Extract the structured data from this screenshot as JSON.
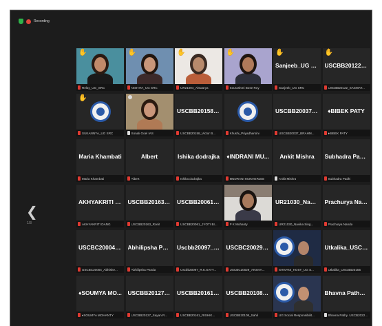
{
  "recording_label": "Recording",
  "page_indicator": "1/3",
  "tiles": [
    {
      "display": "",
      "label": "Relay_UG_SRC",
      "video": true,
      "mic_muted": true,
      "hand": true,
      "bg": "#4a8f9e",
      "skin": "#c08a6a",
      "shirt": "#1a1a1a",
      "hair": "#2a1a12"
    },
    {
      "display": "",
      "label": "NISHITA_UG SRC",
      "video": true,
      "mic_muted": true,
      "hand": true,
      "bg": "#6f8fb0",
      "skin": "#c9977a",
      "shirt": "#3c2a2a",
      "hair": "#22160f"
    },
    {
      "display": "",
      "label": "UR21004_Aiswarya",
      "video": true,
      "mic_muted": true,
      "hand": true,
      "bg": "#ece8e4",
      "skin": "#b88a6c",
      "shirt": "#ba5e3a",
      "hair": "#3a2a22"
    },
    {
      "display": "",
      "label": "Sourashmi Bose Roy",
      "video": true,
      "mic_muted": true,
      "hand": true,
      "bg": "#a9a4ce",
      "skin": "#b07a5a",
      "shirt": "#2d2f3a",
      "hair": "#1f1510"
    },
    {
      "display": "Sanjeeb_UG SRC",
      "label": "Sanjeeb_UG SRC",
      "video": false,
      "mic_muted": true,
      "hand": true
    },
    {
      "display": "USCBB20122_S...",
      "label": "USCBB20122_SASWAT...",
      "video": false,
      "mic_muted": true,
      "hand": true
    },
    {
      "display": "",
      "label": "SUKANNYA_UG SRC",
      "video": false,
      "mic_muted": true,
      "hand": true,
      "logo": true
    },
    {
      "display": "",
      "label": "Sonali Goel IAS",
      "video": true,
      "mic_muted": false,
      "spotlight": true,
      "bg": "#a38f6f",
      "skin": "#c9967a",
      "shirt": "#b07a55",
      "hair": "#2a1a10"
    },
    {
      "display": "USCBB20158_Vi...",
      "label": "USCBB20158_Victor B...",
      "video": false,
      "mic_muted": true
    },
    {
      "display": "",
      "label": "Khushi_Priyadharsini",
      "video": false,
      "mic_muted": true,
      "logo": true
    },
    {
      "display": "USCBB20037_B...",
      "label": "USCBB20037_BRAHM...",
      "video": false,
      "mic_muted": true
    },
    {
      "display": "♦BIBEK PATY",
      "label": "♦BIBEK PATY",
      "video": false,
      "mic_muted": true
    },
    {
      "display": "Maria Khambati",
      "label": "Maria Khambati",
      "video": false,
      "mic_muted": true
    },
    {
      "display": "Albert",
      "label": "Albert",
      "video": false,
      "mic_muted": true
    },
    {
      "display": "Ishika dodrajka",
      "label": "Ishika dodrajka",
      "video": false,
      "mic_muted": true
    },
    {
      "display": "♦INDRANI MU...",
      "label": "♦INDRANI MUKHERJEE",
      "video": false,
      "mic_muted": true
    },
    {
      "display": "Ankit Mishra",
      "label": "Ankit Mishra",
      "video": false,
      "mic_muted": false
    },
    {
      "display": "Subhadra Padhi",
      "label": "Subhadra Padhi",
      "video": false,
      "mic_muted": true
    },
    {
      "display": "AKHYAKRITI DA...",
      "label": "AKHYAKRITI DANG",
      "video": false,
      "mic_muted": true
    },
    {
      "display": "USCBB20163_R...",
      "label": "USCBB20163_Ronit",
      "video": false,
      "mic_muted": true
    },
    {
      "display": "USCBB20061_JY...",
      "label": "USCBB20061_JYOTI BI...",
      "video": false,
      "mic_muted": true
    },
    {
      "display": "",
      "label": "P K Mohanty",
      "video": true,
      "mic_muted": true,
      "bg": "#dcdad6",
      "skin": "#a87a5c",
      "shirt": "#3a3a48",
      "hair": "#1a1410",
      "shelf": true
    },
    {
      "display": "UR21030_Navik...",
      "label": "UR21030_Navika Sing...",
      "video": false,
      "mic_muted": true
    },
    {
      "display": "Prachurya Nanda",
      "label": "Prachurya Nanda",
      "video": false,
      "mic_muted": true
    },
    {
      "display": "USCBC20004_A...",
      "label": "USCBC20004_Abhishe...",
      "video": false,
      "mic_muted": true
    },
    {
      "display": "Abhilipsha Panda",
      "label": "Abhilipsha Panda",
      "video": false,
      "mic_muted": true
    },
    {
      "display": "Uscbb20097_R...",
      "label": "Uscbb20097_R.K.SATY...",
      "video": false,
      "mic_muted": true
    },
    {
      "display": "USCBC20029_A...",
      "label": "USCBC20029_ANSHA...",
      "video": false,
      "mic_muted": true
    },
    {
      "display": "",
      "label": "SHIVANI_HOST_UG S...",
      "video": true,
      "mic_muted": true,
      "logo": true,
      "bg": "#1f2b44",
      "skin": "#b4856a",
      "shirt": "#2a2a2a",
      "hair": "#1a120c"
    },
    {
      "display": "Utkalika_USCBB...",
      "label": "Utkalika_USCBB20155",
      "video": false,
      "mic_muted": true
    },
    {
      "display": "♦SOUMYA MO...",
      "label": "♦SOUMYA MOHANTY",
      "video": false,
      "mic_muted": true
    },
    {
      "display": "USCBB20127_Sa...",
      "label": "USCBB20127_Sayan R...",
      "video": false,
      "mic_muted": true
    },
    {
      "display": "USCBB20161_R...",
      "label": "USCBB20161_RISHIK...",
      "video": false,
      "mic_muted": true
    },
    {
      "display": "USCBB20108_S...",
      "label": "USCBB20108_Sahil",
      "video": false,
      "mic_muted": true
    },
    {
      "display": "",
      "label": "UG Social Responsibilit...",
      "video": true,
      "mic_muted": true,
      "logo": true,
      "bg": "#2a3550",
      "skin": "#c29072",
      "shirt": "#2f2f2f",
      "hair": "#1b120c"
    },
    {
      "display": "Bhavna Pathy. U...",
      "label": "Bhavna Pathy. USCB2022...",
      "video": false,
      "mic_muted": false
    }
  ]
}
